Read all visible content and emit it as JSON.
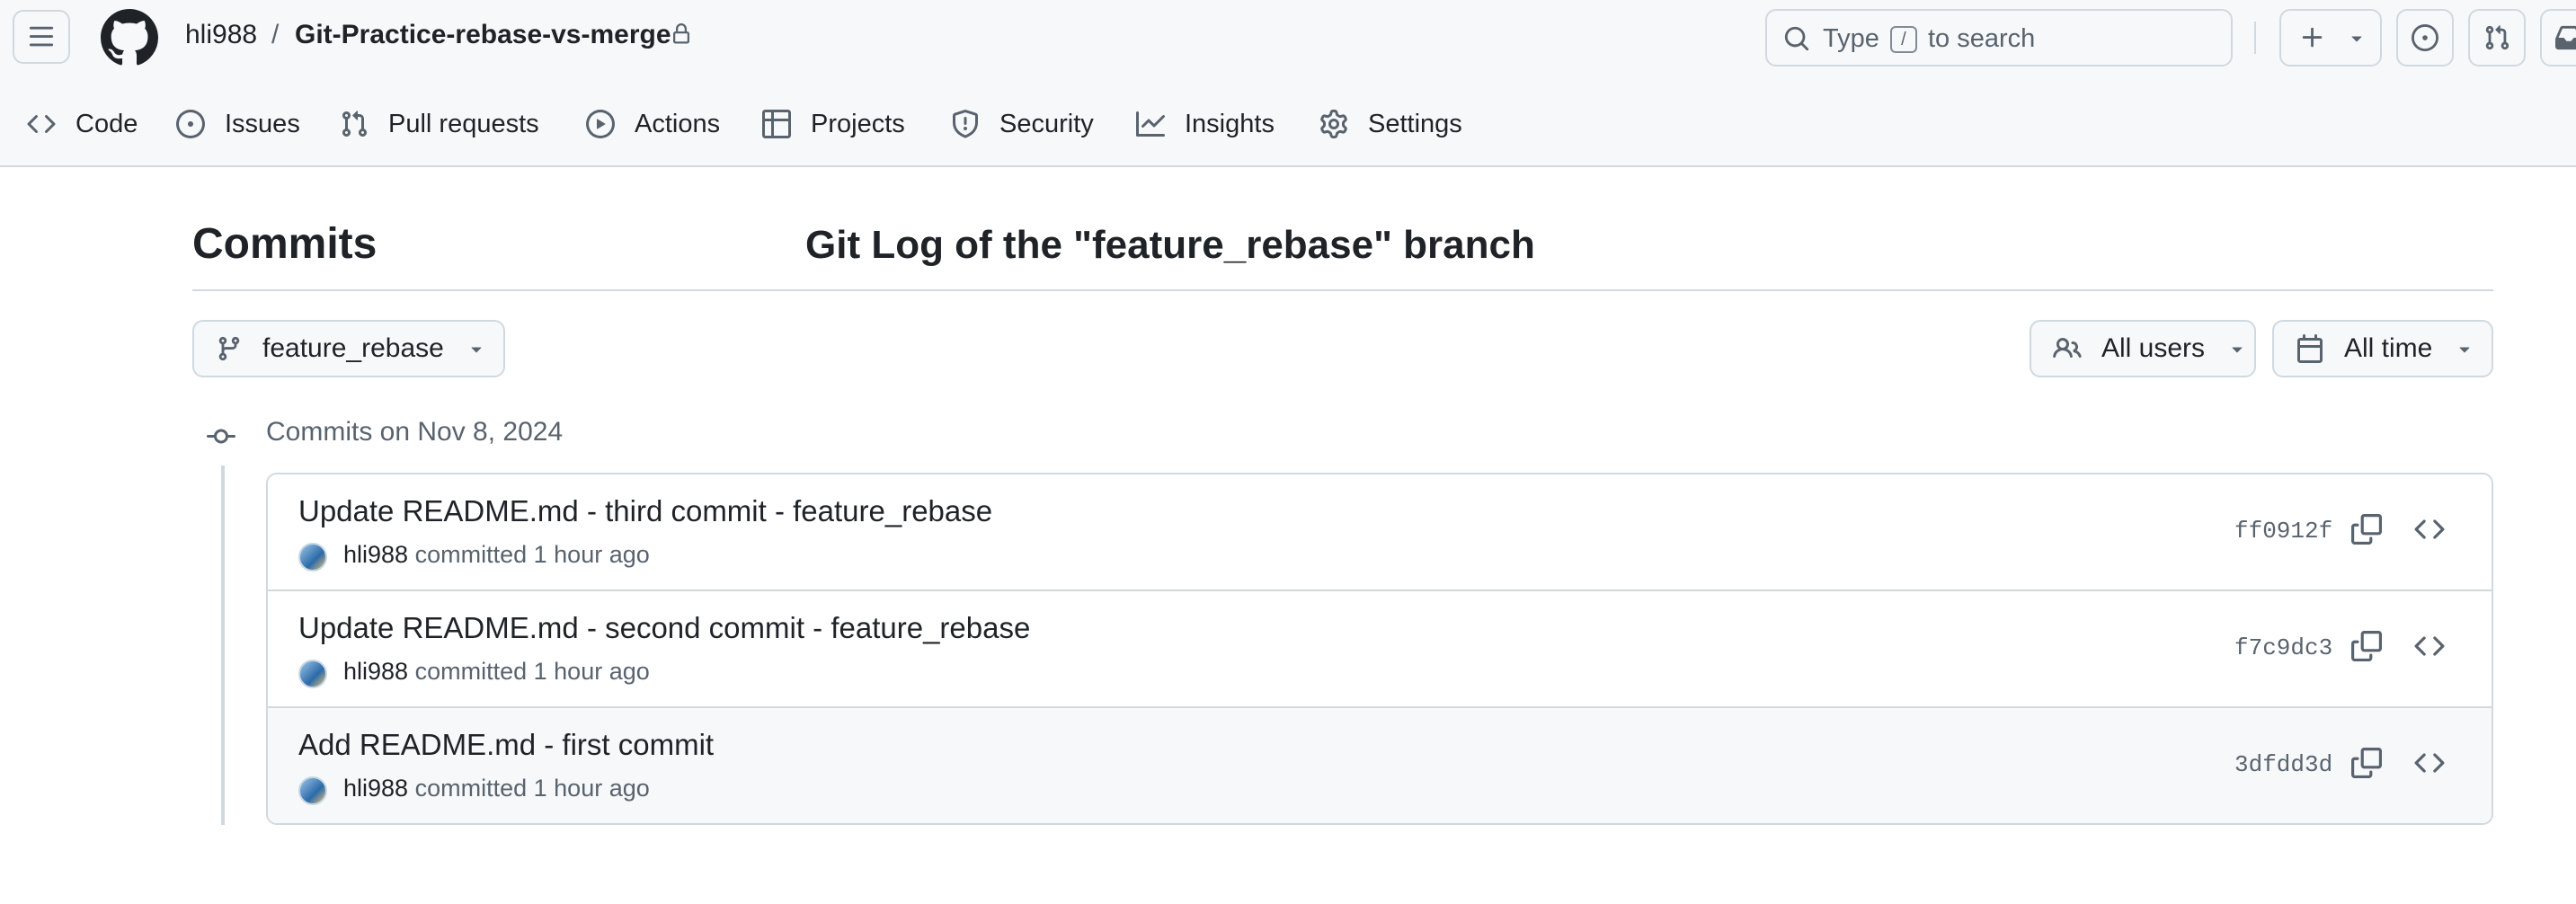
{
  "repo": {
    "owner": "hli988",
    "slash": "/",
    "name": "Git-Practice-rebase-vs-merge"
  },
  "search": {
    "prefix": "Type",
    "key": "/",
    "suffix": "to search"
  },
  "nav": {
    "tabs": [
      {
        "label": "Code",
        "icon": "code-icon"
      },
      {
        "label": "Issues",
        "icon": "issue-opened-icon"
      },
      {
        "label": "Pull requests",
        "icon": "git-pull-request-icon"
      },
      {
        "label": "Actions",
        "icon": "play-icon"
      },
      {
        "label": "Projects",
        "icon": "table-icon"
      },
      {
        "label": "Security",
        "icon": "shield-icon"
      },
      {
        "label": "Insights",
        "icon": "graph-icon"
      },
      {
        "label": "Settings",
        "icon": "gear-icon"
      }
    ]
  },
  "page": {
    "title": "Commits",
    "overlay_title": "Git Log of the \"feature_rebase\" branch"
  },
  "filters": {
    "branch": "feature_rebase",
    "users": "All users",
    "time": "All time"
  },
  "group": {
    "date_label": "Commits on Nov 8, 2024",
    "commits": [
      {
        "message": "Update README.md - third commit - feature_rebase",
        "author": "hli988",
        "action": "committed",
        "when": "1 hour ago",
        "sha": "ff0912f"
      },
      {
        "message": "Update README.md - second commit - feature_rebase",
        "author": "hli988",
        "action": "committed",
        "when": "1 hour ago",
        "sha": "f7c9dc3"
      },
      {
        "message": "Add README.md - first commit",
        "author": "hli988",
        "action": "committed",
        "when": "1 hour ago",
        "sha": "3dfdd3d"
      }
    ]
  },
  "colors": {
    "text": "#1f2328",
    "muted": "#59636e",
    "border": "#d1d9e0",
    "canvas_subtle": "#f6f8fa"
  }
}
